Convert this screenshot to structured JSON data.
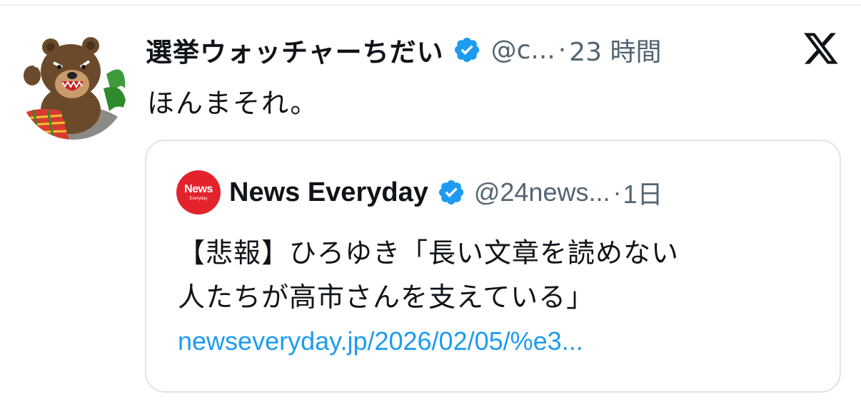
{
  "tweet": {
    "display_name": "選挙ウォッチャーちだい",
    "handle": "@c...",
    "separator": "·",
    "time": "23 時間",
    "text": "ほんまそれ。",
    "avatar_icon": "bear-avatar-icon",
    "verified_icon": "verified-badge-icon",
    "platform_icon": "x-logo-icon"
  },
  "quote": {
    "avatar_main": "News",
    "avatar_sub": "Everyday",
    "display_name": "News Everyday",
    "handle": "@24news...",
    "separator": "·",
    "time": "1日",
    "text_line1": "【悲報】ひろゆき「長い文章を読めない",
    "text_line2": "人たちが高市さんを支えている」",
    "link": "newseveryday.jp/2026/02/05/%e3..."
  },
  "colors": {
    "text": "#0f1419",
    "secondary": "#536471",
    "link": "#1d9bf0",
    "verified": "#1d9bf0",
    "news_brand": "#e3232c",
    "border": "#dfe4e8"
  }
}
